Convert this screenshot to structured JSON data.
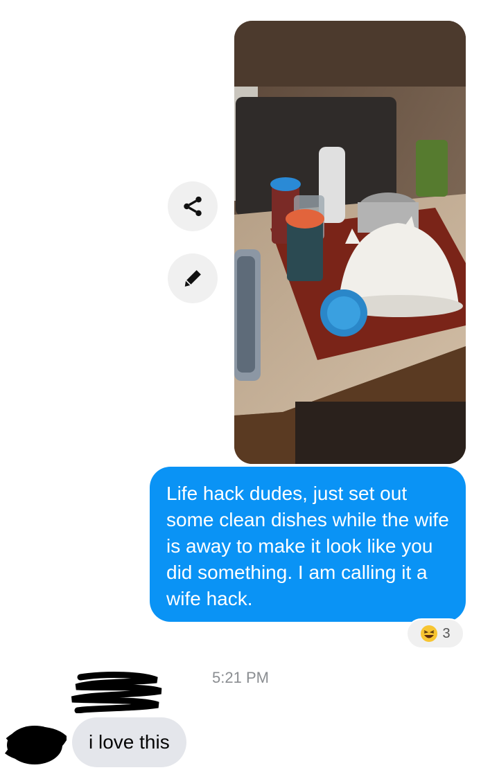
{
  "message_out": {
    "text": "Life hack dudes, just set out some clean dishes while the wife is away to make it look like you did something.  I am calling it a wife hack."
  },
  "reaction": {
    "emoji_icon": "laughing-face-icon",
    "count": "3"
  },
  "timestamp": "5:21 PM",
  "message_in": {
    "text": "i love this"
  },
  "icons": {
    "share": "share-icon",
    "edit": "pencil-icon"
  },
  "colors": {
    "outgoing_bubble": "#0a93f5",
    "incoming_bubble": "#e4e6eb"
  }
}
